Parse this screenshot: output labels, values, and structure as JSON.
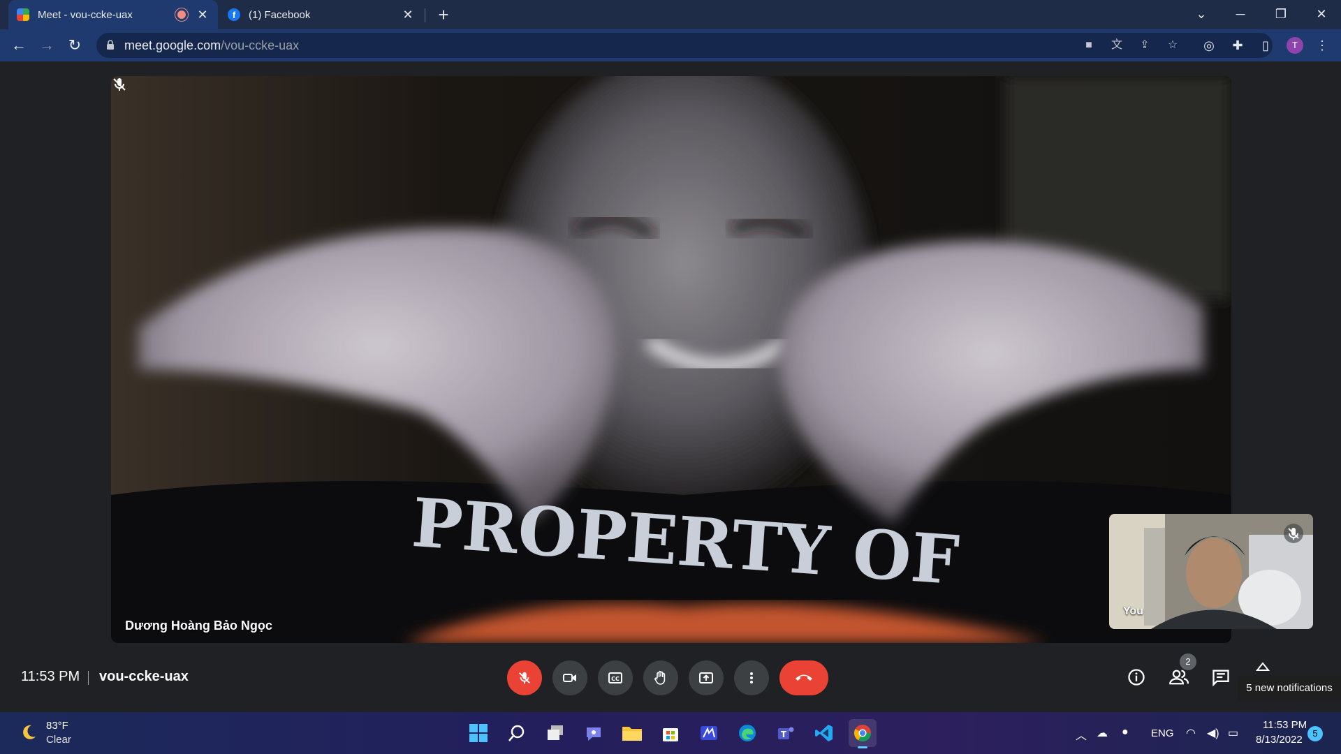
{
  "browser": {
    "tabs": [
      {
        "title": "Meet - vou-ccke-uax",
        "favicon": "google-meet-icon",
        "recording": true,
        "active": true
      },
      {
        "title": "(1) Facebook",
        "favicon": "facebook-icon",
        "active": false
      }
    ],
    "url_host": "meet.google.com",
    "url_path": "/vou-ccke-uax",
    "profile_initial": "T"
  },
  "meet": {
    "main_participant": "Dương Hoàng Bảo Ngọc",
    "shirt_text": "PROPERTY OF",
    "self_label": "You",
    "time": "11:53 PM",
    "meeting_code": "vou-ccke-uax",
    "participants_count": "2",
    "notification": "5 new notifications",
    "colors": {
      "leave": "#ea4335",
      "control_bg": "#3c4043",
      "mic_off": "#ea4335"
    }
  },
  "taskbar": {
    "weather_temp": "83°F",
    "weather_condition": "Clear",
    "language": "ENG",
    "clock_time": "11:53 PM",
    "clock_date": "8/13/2022",
    "notification_count": "5"
  }
}
